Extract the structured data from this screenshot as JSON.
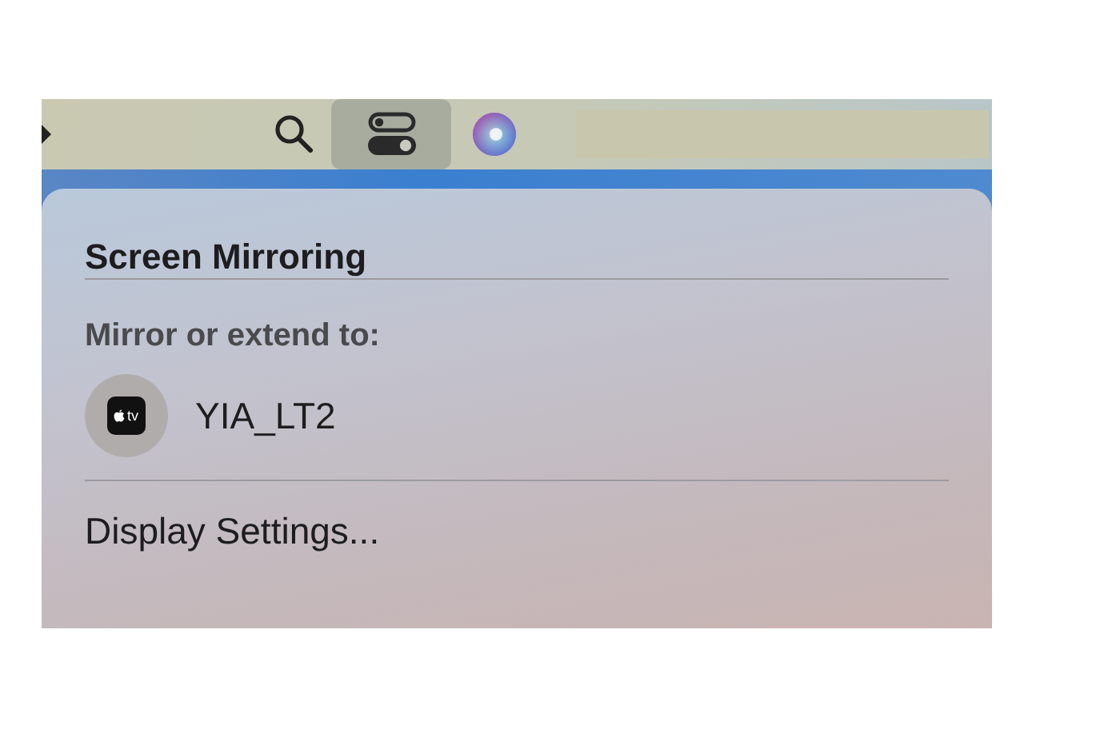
{
  "menu_bar": {
    "items": [
      {
        "kind": "search",
        "selected": false
      },
      {
        "kind": "control_center",
        "selected": true
      },
      {
        "kind": "siri",
        "selected": false
      }
    ]
  },
  "panel": {
    "title": "Screen Mirroring",
    "section_label": "Mirror or extend to:",
    "devices": [
      {
        "name": "YIA_LT2",
        "icon_label": "tv"
      }
    ],
    "footer_item": "Display Settings..."
  }
}
